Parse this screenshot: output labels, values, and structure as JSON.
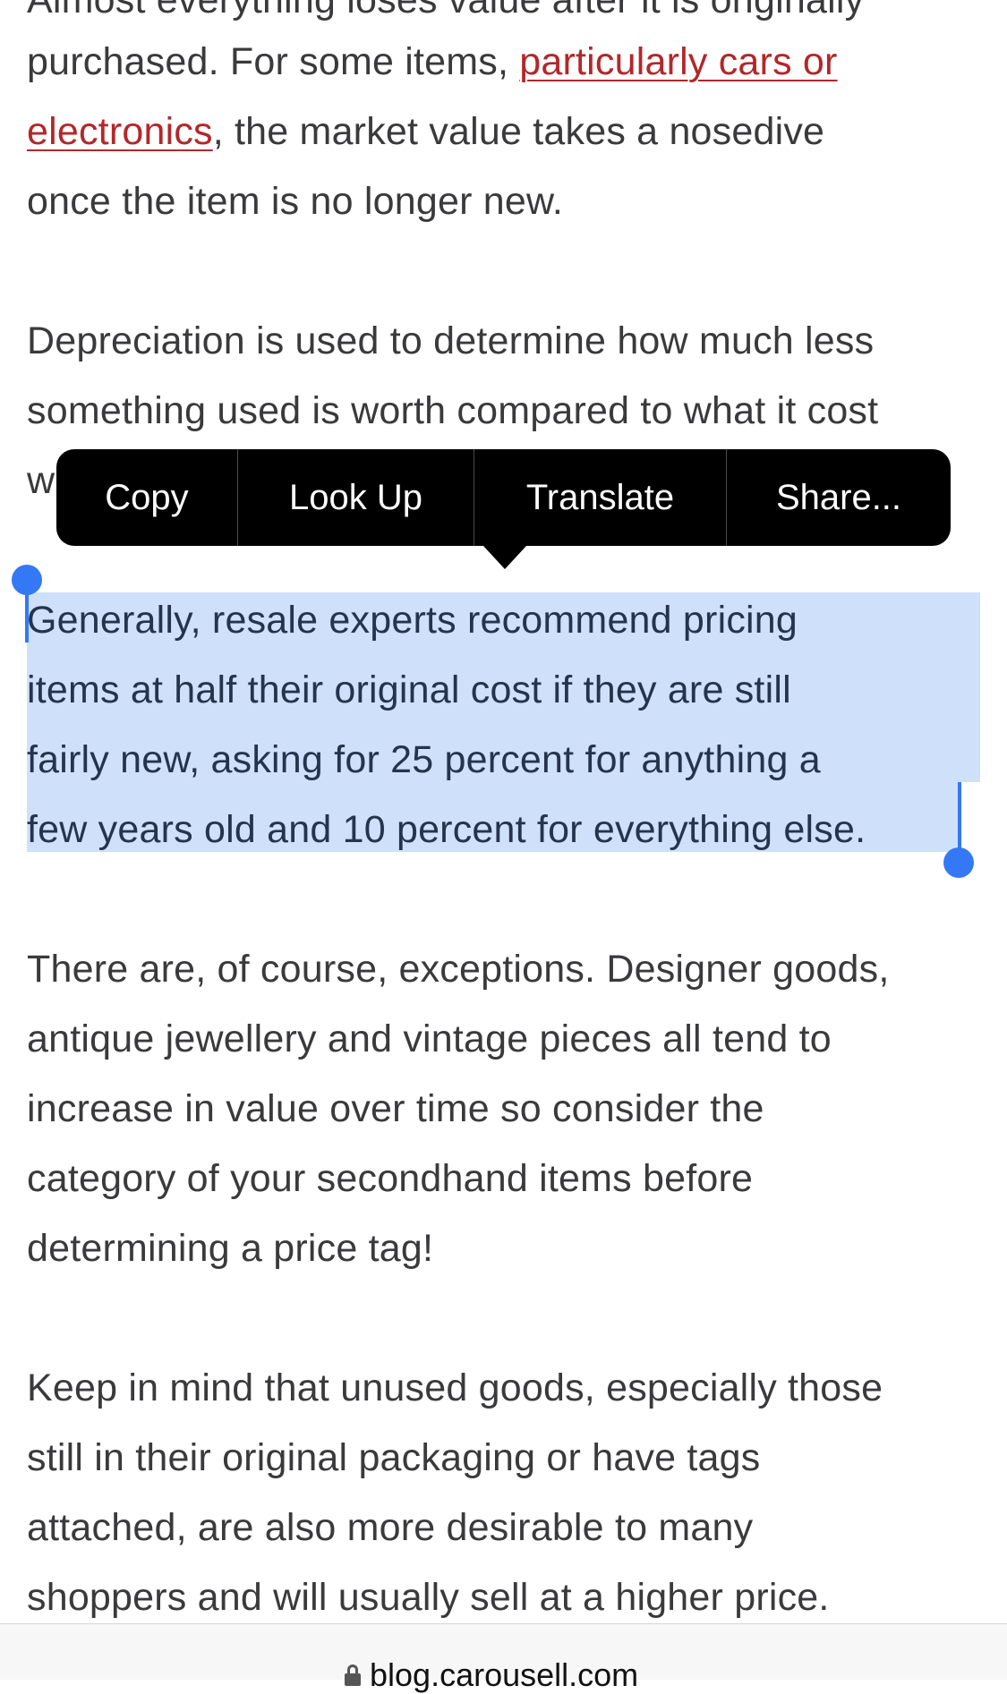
{
  "article": {
    "p0_cut_line": "Almost everything loses value after it is originally",
    "p0_l1_a": "purchased. For some items, ",
    "p0_link_a": "particularly cars or",
    "p0_link_b": "electronics",
    "p0_l2_b": ", the market value takes a nosedive",
    "p0_l3": "once the item is no longer new.",
    "p1_l1": "Depreciation is used to determine how much less",
    "p1_l2": "something used is worth compared to what it cost",
    "p1_l3_partial": "w",
    "p2_l1": "Generally, resale experts recommend pricing",
    "p2_l2": "items at half their original cost if they are still",
    "p2_l3": "fairly new, asking for 25 percent for anything a",
    "p2_l4": "few years old and 10 percent for everything else.",
    "p3_l1": "There are, of course, exceptions. Designer goods,",
    "p3_l2": "antique jewellery and vintage pieces all tend to",
    "p3_l3": "increase in value over time so consider the",
    "p3_l4": "category of your secondhand items before",
    "p3_l5": "determining a price tag!",
    "p4_l1": "Keep in mind that unused goods, especially those",
    "p4_l2": "still in their original packaging or have tags",
    "p4_l3": "attached, are also more desirable to many",
    "p4_l4": "shoppers and will usually sell at a higher price."
  },
  "edit_menu": {
    "copy": "Copy",
    "look_up": "Look Up",
    "translate": "Translate",
    "share": "Share..."
  },
  "address_bar": {
    "domain": "blog.carousell.com",
    "icon": "lock-icon"
  },
  "colors": {
    "link": "#b3272a",
    "selection": "#cfe0fa",
    "handle": "#3478f6",
    "menu_bg": "#000000"
  }
}
